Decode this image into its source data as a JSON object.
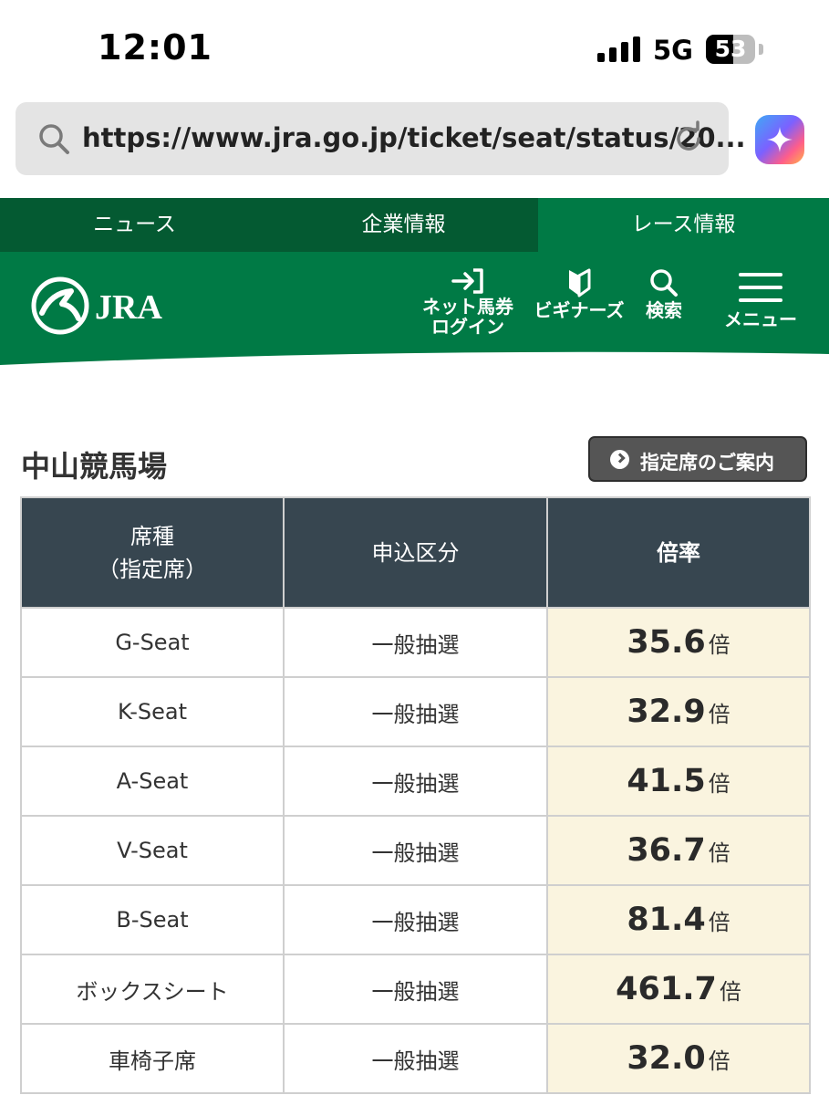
{
  "status_bar": {
    "time": "12:01",
    "network": "5G",
    "battery": "53"
  },
  "browser": {
    "url": "https://www.jra.go.jp/ticket/seat/status/20..."
  },
  "top_nav": [
    {
      "label": "ニュース"
    },
    {
      "label": "企業情報"
    },
    {
      "label": "レース情報",
      "active": true
    }
  ],
  "header": {
    "logo_text": "JRA",
    "icons": [
      {
        "name": "login-icon",
        "label_line1": "ネット馬券",
        "label_line2": "ログイン"
      },
      {
        "name": "beginner-mark-icon",
        "label_line1": "ビギナーズ"
      },
      {
        "name": "search-icon",
        "label_line1": "検索"
      },
      {
        "name": "hamburger-menu-icon",
        "label_line1": "メニュー"
      }
    ]
  },
  "section": {
    "title": "中山競馬場",
    "guide_button": "指定席のご案内"
  },
  "table": {
    "headers": {
      "seat_line1": "席種",
      "seat_line2": "（指定席）",
      "application": "申込区分",
      "ratio": "倍率"
    },
    "rows": [
      {
        "seat": "G-Seat",
        "application": "一般抽選",
        "ratio": "35.6",
        "unit": "倍"
      },
      {
        "seat": "K-Seat",
        "application": "一般抽選",
        "ratio": "32.9",
        "unit": "倍"
      },
      {
        "seat": "A-Seat",
        "application": "一般抽選",
        "ratio": "41.5",
        "unit": "倍"
      },
      {
        "seat": "V-Seat",
        "application": "一般抽選",
        "ratio": "36.7",
        "unit": "倍"
      },
      {
        "seat": "B-Seat",
        "application": "一般抽選",
        "ratio": "81.4",
        "unit": "倍"
      },
      {
        "seat": "ボックスシート",
        "application": "一般抽選",
        "ratio": "461.7",
        "unit": "倍"
      },
      {
        "seat": "車椅子席",
        "application": "一般抽選",
        "ratio": "32.0",
        "unit": "倍"
      }
    ]
  },
  "colors": {
    "brand_green": "#007a45",
    "dark_green": "#045a32",
    "table_header": "#374650",
    "ratio_cell": "#faf4df"
  }
}
